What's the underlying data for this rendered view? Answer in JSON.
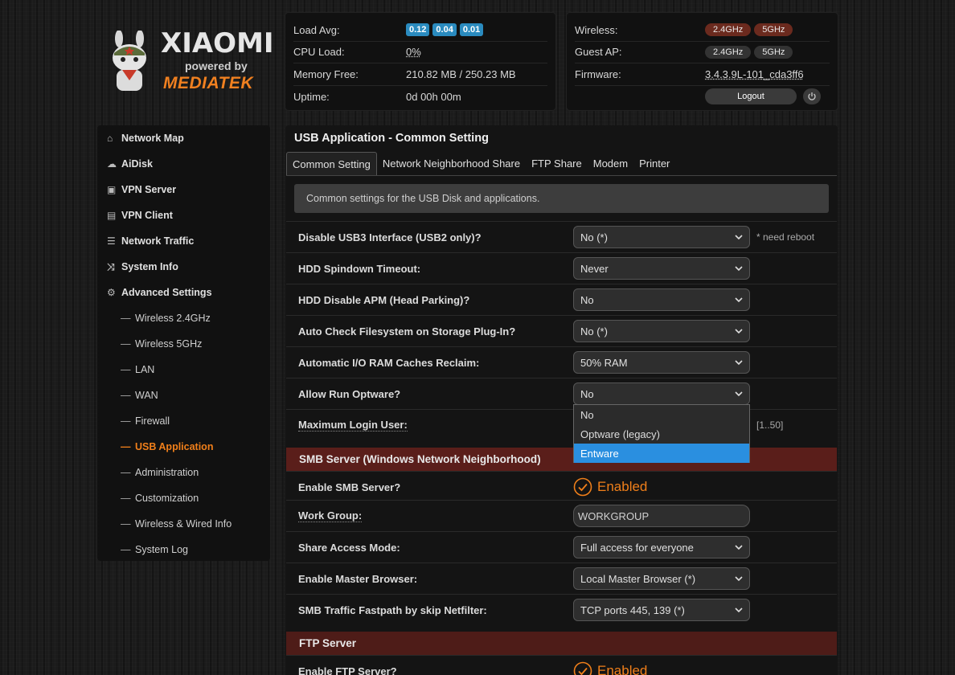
{
  "brand": {
    "name": "XIAOMI",
    "powered_by": "powered by",
    "partner": "MEDIATEK"
  },
  "status_left": {
    "load_avg_label": "Load Avg:",
    "load_avg": [
      "0.12",
      "0.04",
      "0.01"
    ],
    "cpu_load_label": "CPU Load:",
    "cpu_load": "0%",
    "memory_free_label": "Memory Free:",
    "memory_free": "210.82 MB / 250.23 MB",
    "uptime_label": "Uptime:",
    "uptime": "0d 00h 00m"
  },
  "status_right": {
    "wireless_label": "Wireless:",
    "wireless_24": "2.4GHz",
    "wireless_5": "5GHz",
    "guest_label": "Guest AP:",
    "guest_24": "2.4GHz",
    "guest_5": "5GHz",
    "firmware_label": "Firmware:",
    "firmware": "3.4.3.9L-101_cda3ff6",
    "logout": "Logout"
  },
  "sidebar": {
    "items": [
      {
        "label": "Network Map",
        "icon": "home-icon"
      },
      {
        "label": "AiDisk",
        "icon": "cloud-icon"
      },
      {
        "label": "VPN Server",
        "icon": "vpn-server-icon"
      },
      {
        "label": "VPN Client",
        "icon": "vpn-client-icon"
      },
      {
        "label": "Network Traffic",
        "icon": "traffic-icon"
      },
      {
        "label": "System Info",
        "icon": "shuffle-icon"
      },
      {
        "label": "Advanced Settings",
        "icon": "gear-icon"
      }
    ],
    "sub_items": [
      "Wireless 2.4GHz",
      "Wireless 5GHz",
      "LAN",
      "WAN",
      "Firewall",
      "USB Application",
      "Administration",
      "Customization",
      "Wireless & Wired Info",
      "System Log"
    ],
    "active_sub": "USB Application"
  },
  "main": {
    "title": "USB Application - Common Setting",
    "tabs": [
      "Common Setting",
      "Network Neighborhood Share",
      "FTP Share",
      "Modem",
      "Printer"
    ],
    "active_tab": "Common Setting",
    "info": "Common settings for the USB Disk and applications.",
    "rows": [
      {
        "label": "Disable USB3 Interface (USB2 only)?",
        "value": "No (*)",
        "note": "* need reboot"
      },
      {
        "label": "HDD Spindown Timeout:",
        "value": "Never"
      },
      {
        "label": "HDD Disable APM (Head Parking)?",
        "value": "No"
      },
      {
        "label": "Auto Check Filesystem on Storage Plug-In?",
        "value": "No (*)"
      },
      {
        "label": "Automatic I/O RAM Caches Reclaim:",
        "value": "50% RAM"
      },
      {
        "label": "Allow Run Optware?",
        "value": "No"
      },
      {
        "label": "Maximum Login User:",
        "value": "",
        "note": "[1..50]"
      }
    ],
    "smb_header": "SMB Server (Windows Network Neighborhood)",
    "smb_rows": [
      {
        "label": "Enable SMB Server?",
        "value": "Enabled"
      },
      {
        "label": "Work Group:",
        "value": "WORKGROUP"
      },
      {
        "label": "Share Access Mode:",
        "value": "Full access for everyone"
      },
      {
        "label": "Enable Master Browser:",
        "value": "Local Master Browser (*)"
      },
      {
        "label": "SMB Traffic Fastpath by skip Netfilter:",
        "value": "TCP ports 445, 139 (*)"
      }
    ],
    "ftp_header": "FTP Server",
    "ftp_rows": [
      {
        "label": "Enable FTP Server?",
        "value": "Enabled"
      }
    ]
  },
  "dropdown": {
    "options": [
      "No",
      "Optware (legacy)",
      "Entware"
    ],
    "highlighted": "Entware"
  },
  "colors": {
    "accent": "#f07f1a",
    "section_header": "#5a1e1a",
    "load_badge": "#2a8bbf",
    "dropdown_highlight": "#2a8fe0"
  }
}
